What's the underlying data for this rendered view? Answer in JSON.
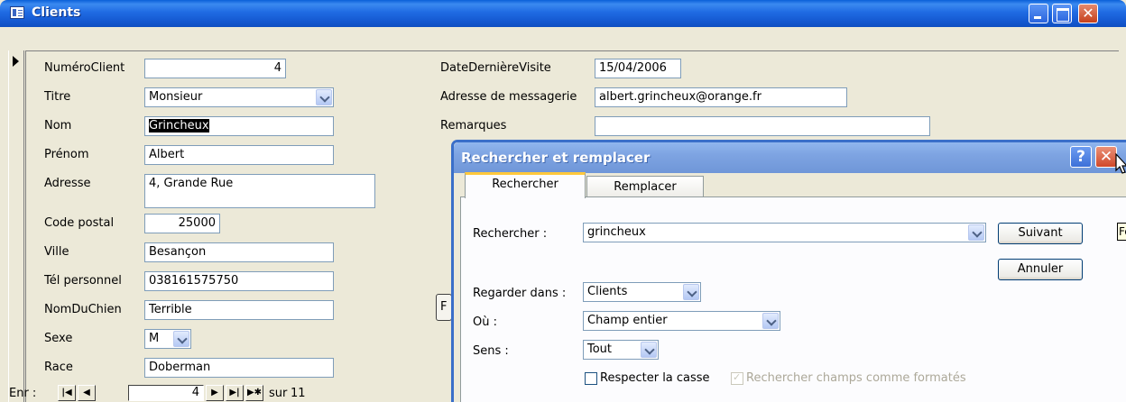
{
  "window": {
    "title": "Clients"
  },
  "form": {
    "fields": {
      "numero_client": {
        "label": "NuméroClient",
        "value": "4"
      },
      "titre": {
        "label": "Titre",
        "value": "Monsieur"
      },
      "nom": {
        "label": "Nom",
        "value": "Grincheux"
      },
      "prenom": {
        "label": "Prénom",
        "value": "Albert"
      },
      "adresse": {
        "label": "Adresse",
        "value": "4, Grande Rue"
      },
      "code_postal": {
        "label": "Code postal",
        "value": "25000"
      },
      "ville": {
        "label": "Ville",
        "value": "Besançon"
      },
      "tel_personnel": {
        "label": "Tél personnel",
        "value": "038161575750"
      },
      "nom_du_chien": {
        "label": "NomDuChien",
        "value": "Terrible"
      },
      "sexe": {
        "label": "Sexe",
        "value": "M"
      },
      "race": {
        "label": "Race",
        "value": "Doberman"
      },
      "date_derniere_visite": {
        "label": "DateDernièreVisite",
        "value": "15/04/2006"
      },
      "adresse_messagerie": {
        "label": "Adresse de messagerie",
        "value": "albert.grincheux@orange.fr"
      },
      "remarques": {
        "label": "Remarques",
        "value": ""
      }
    },
    "partial_button_text": "F"
  },
  "record_nav": {
    "label": "Enr :",
    "current": "4",
    "of_label": "sur",
    "total": "11",
    "icons": [
      "first-record-icon",
      "previous-record-icon",
      "next-record-icon",
      "last-record-icon",
      "new-record-icon"
    ]
  },
  "dialog": {
    "title": "Rechercher et remplacer",
    "help_label": "?",
    "tabs": [
      {
        "label": "Rechercher",
        "active": true
      },
      {
        "label": "Remplacer",
        "active": false
      }
    ],
    "search_label": "Rechercher :",
    "search_value": "grincheux",
    "look_in_label": "Regarder dans :",
    "look_in_value": "Clients",
    "where_label": "Où :",
    "where_value": "Champ entier",
    "direction_label": "Sens :",
    "direction_value": "Tout",
    "match_case_label": "Respecter la casse",
    "match_case_checked": false,
    "search_formatted_label": "Rechercher champs comme formatés",
    "search_formatted_checked": true,
    "next_button": "Suivant",
    "cancel_button": "Annuler",
    "tooltip_text": "Fe"
  },
  "colors": {
    "titlebar": "#1F6BE3",
    "dialog_titlebar": "#7EA4E2",
    "close_button": "#C6401B",
    "tab_highlight": "#FFC83C",
    "face": "#ECE9D8"
  }
}
